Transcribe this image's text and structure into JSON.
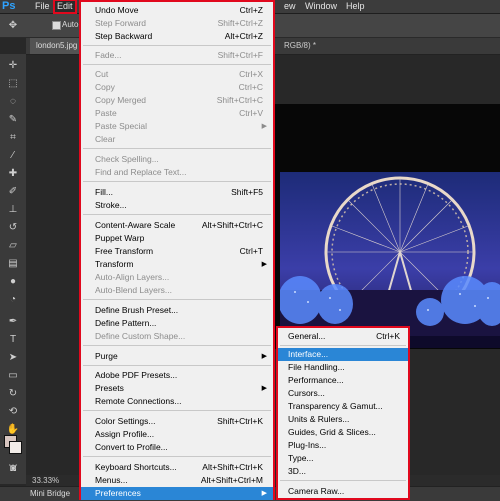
{
  "app": {
    "logo": "Ps"
  },
  "menubar": {
    "file": "File",
    "edit": "Edit",
    "view": "ew",
    "window": "Window",
    "help": "Help"
  },
  "options": {
    "auto": "Auto-"
  },
  "document": {
    "tab": "london5.jpg",
    "tab_right": "RGB/8) *"
  },
  "status": {
    "zoom": "33.33%"
  },
  "bottom": {
    "mini_bridge": "Mini Bridge"
  },
  "edit_menu": {
    "undo": {
      "label": "Undo Move",
      "shortcut": "Ctrl+Z"
    },
    "step_forward": {
      "label": "Step Forward",
      "shortcut": "Shift+Ctrl+Z"
    },
    "step_backward": {
      "label": "Step Backward",
      "shortcut": "Alt+Ctrl+Z"
    },
    "fade": {
      "label": "Fade...",
      "shortcut": "Shift+Ctrl+F"
    },
    "cut": {
      "label": "Cut",
      "shortcut": "Ctrl+X"
    },
    "copy": {
      "label": "Copy",
      "shortcut": "Ctrl+C"
    },
    "copy_merged": {
      "label": "Copy Merged",
      "shortcut": "Shift+Ctrl+C"
    },
    "paste": {
      "label": "Paste",
      "shortcut": "Ctrl+V"
    },
    "paste_special": {
      "label": "Paste Special"
    },
    "clear": {
      "label": "Clear"
    },
    "check_spelling": {
      "label": "Check Spelling..."
    },
    "find_replace": {
      "label": "Find and Replace Text..."
    },
    "fill": {
      "label": "Fill...",
      "shortcut": "Shift+F5"
    },
    "stroke": {
      "label": "Stroke..."
    },
    "content_aware_scale": {
      "label": "Content-Aware Scale",
      "shortcut": "Alt+Shift+Ctrl+C"
    },
    "puppet_warp": {
      "label": "Puppet Warp"
    },
    "free_transform": {
      "label": "Free Transform",
      "shortcut": "Ctrl+T"
    },
    "transform": {
      "label": "Transform"
    },
    "auto_align": {
      "label": "Auto-Align Layers..."
    },
    "auto_blend": {
      "label": "Auto-Blend Layers..."
    },
    "define_brush": {
      "label": "Define Brush Preset..."
    },
    "define_pattern": {
      "label": "Define Pattern..."
    },
    "define_shape": {
      "label": "Define Custom Shape..."
    },
    "purge": {
      "label": "Purge"
    },
    "pdf_presets": {
      "label": "Adobe PDF Presets..."
    },
    "presets": {
      "label": "Presets"
    },
    "remote_connections": {
      "label": "Remote Connections..."
    },
    "color_settings": {
      "label": "Color Settings...",
      "shortcut": "Shift+Ctrl+K"
    },
    "assign_profile": {
      "label": "Assign Profile..."
    },
    "convert_profile": {
      "label": "Convert to Profile..."
    },
    "keyboard_shortcuts": {
      "label": "Keyboard Shortcuts...",
      "shortcut": "Alt+Shift+Ctrl+K"
    },
    "menus": {
      "label": "Menus...",
      "shortcut": "Alt+Shift+Ctrl+M"
    },
    "preferences": {
      "label": "Preferences"
    }
  },
  "preferences_menu": {
    "general": {
      "label": "General...",
      "shortcut": "Ctrl+K"
    },
    "interface": {
      "label": "Interface..."
    },
    "file_handling": {
      "label": "File Handling..."
    },
    "performance": {
      "label": "Performance..."
    },
    "cursors": {
      "label": "Cursors..."
    },
    "transparency": {
      "label": "Transparency & Gamut..."
    },
    "units": {
      "label": "Units & Rulers..."
    },
    "guides": {
      "label": "Guides, Grid & Slices..."
    },
    "plugins": {
      "label": "Plug-Ins..."
    },
    "type": {
      "label": "Type..."
    },
    "three_d": {
      "label": "3D..."
    },
    "camera_raw": {
      "label": "Camera Raw..."
    }
  },
  "colors": {
    "accent_red": "#e1081d",
    "highlight": "#2a86d6",
    "ps_blue": "#2fa3ff"
  }
}
